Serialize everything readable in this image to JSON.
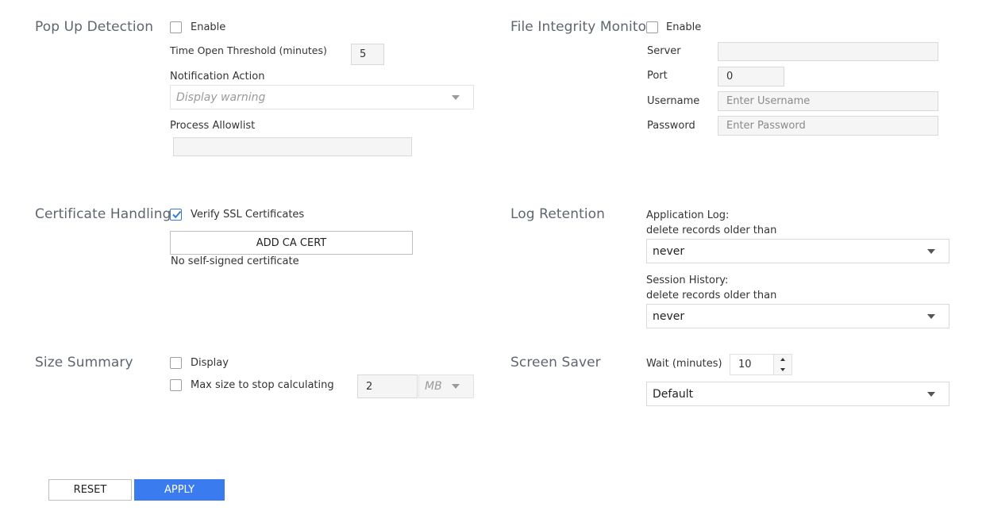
{
  "popup": {
    "title": "Pop Up Detection",
    "enable_label": "Enable",
    "enable_checked": false,
    "threshold_label": "Time Open Threshold (minutes)",
    "threshold_value": "5",
    "notification_label": "Notification Action",
    "notification_value": "Display warning",
    "allowlist_label": "Process Allowlist",
    "allowlist_value": ""
  },
  "fim": {
    "title": "File Integrity Monitor",
    "enable_label": "Enable",
    "enable_checked": false,
    "server_label": "Server",
    "server_value": "",
    "port_label": "Port",
    "port_value": "0",
    "username_label": "Username",
    "username_placeholder": "Enter Username",
    "password_label": "Password",
    "password_placeholder": "Enter Password"
  },
  "cert": {
    "title": "Certificate Handling",
    "verify_label": "Verify SSL Certificates",
    "verify_checked": true,
    "add_button": "ADD CA CERT",
    "status_text": "No self-signed certificate"
  },
  "log": {
    "title": "Log Retention",
    "app_label_1": "Application Log:",
    "app_label_2": "delete records older than",
    "app_value": "never",
    "session_label_1": "Session History:",
    "session_label_2": "delete records older than",
    "session_value": "never"
  },
  "size": {
    "title": "Size Summary",
    "display_label": "Display",
    "display_checked": false,
    "maxsize_label": "Max size to stop calculating",
    "maxsize_checked": false,
    "maxsize_value": "2",
    "unit_value": "MB"
  },
  "saver": {
    "title": "Screen Saver",
    "wait_label": "Wait (minutes)",
    "wait_value": "10",
    "mode_value": "Default"
  },
  "actions": {
    "reset_label": "RESET",
    "apply_label": "APPLY"
  },
  "colors": {
    "accent": "#3a7bf0",
    "section_title": "#5f6670"
  }
}
